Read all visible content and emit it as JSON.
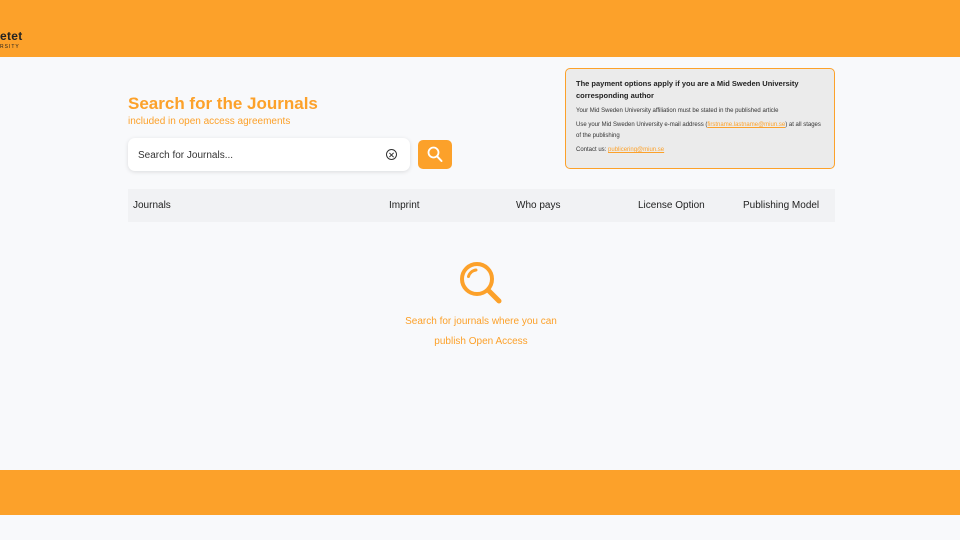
{
  "header": {
    "logo_name": "etet",
    "logo_sub": "RSITY",
    "color": "#fca12a"
  },
  "search": {
    "title": "Search for the Journals",
    "subtitle": "included in open access agreements",
    "placeholder": "Search for Journals...",
    "value": "",
    "clear_icon": "clear-circle-x-icon",
    "button_icon": "search-icon"
  },
  "info": {
    "title": "The payment options apply if you are a Mid Sweden University corresponding author",
    "line1": "Your Mid Sweden University affiliation must be stated in the published article",
    "line2_prefix": "Use your Mid Sweden University e-mail address (",
    "line2_link": "firstname.lastname@miun.se",
    "line2_suffix": ") at all stages of the publishing",
    "line3_prefix": "Contact us: ",
    "line3_link": "publicering@miun.se"
  },
  "table": {
    "columns": [
      "Journals",
      "Imprint",
      "Who pays",
      "License Option",
      "Publishing Model"
    ]
  },
  "empty_state": {
    "icon": "search-icon",
    "line1": "Search for journals where you can",
    "line2": "publish Open Access"
  }
}
